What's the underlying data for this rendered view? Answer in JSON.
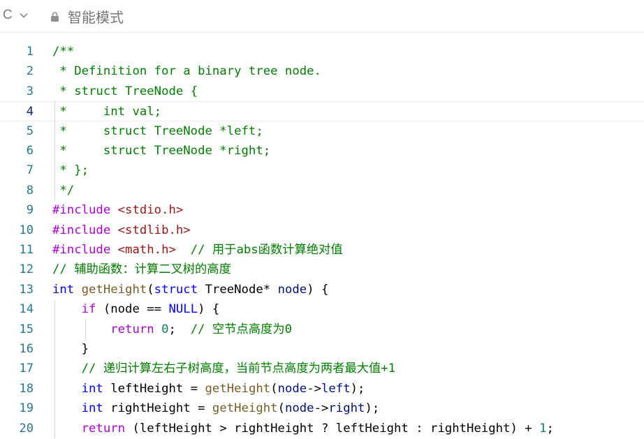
{
  "toolbar": {
    "language": "C",
    "language_dropdown_icon": "chevron-down-icon",
    "mode_icon": "lock-icon",
    "mode_label": "智能模式"
  },
  "editor": {
    "current_line": 4,
    "colors": {
      "line_number": "#237893",
      "comment": "#008000",
      "keyword": "#0000ff",
      "control": "#af00db",
      "string": "#a31515",
      "function": "#795e26",
      "type": "#267f99",
      "variable": "#001080",
      "number": "#098658"
    },
    "lines": [
      {
        "n": "1",
        "tokens": [
          {
            "c": "comment",
            "t": "/**"
          }
        ]
      },
      {
        "n": "2",
        "tokens": [
          {
            "c": "comment",
            "t": " * Definition for a binary tree node."
          }
        ]
      },
      {
        "n": "3",
        "tokens": [
          {
            "c": "comment",
            "t": " * struct TreeNode {"
          }
        ]
      },
      {
        "n": "4",
        "tokens": [
          {
            "c": "comment",
            "t": " *     int val;"
          }
        ]
      },
      {
        "n": "5",
        "tokens": [
          {
            "c": "comment",
            "t": " *     struct TreeNode *left;"
          }
        ]
      },
      {
        "n": "6",
        "tokens": [
          {
            "c": "comment",
            "t": " *     struct TreeNode *right;"
          }
        ]
      },
      {
        "n": "7",
        "tokens": [
          {
            "c": "comment",
            "t": " * };"
          }
        ]
      },
      {
        "n": "8",
        "tokens": [
          {
            "c": "comment",
            "t": " */"
          }
        ]
      },
      {
        "n": "9",
        "tokens": [
          {
            "c": "ctrl",
            "t": "#include"
          },
          {
            "c": "plain",
            "t": " "
          },
          {
            "c": "str",
            "t": "<stdio.h>"
          }
        ]
      },
      {
        "n": "10",
        "tokens": [
          {
            "c": "ctrl",
            "t": "#include"
          },
          {
            "c": "plain",
            "t": " "
          },
          {
            "c": "str",
            "t": "<stdlib.h>"
          }
        ]
      },
      {
        "n": "11",
        "tokens": [
          {
            "c": "ctrl",
            "t": "#include"
          },
          {
            "c": "plain",
            "t": " "
          },
          {
            "c": "str",
            "t": "<math.h>"
          },
          {
            "c": "plain",
            "t": "  "
          },
          {
            "c": "comment",
            "t": "// 用于abs函数计算绝对值"
          }
        ]
      },
      {
        "n": "12",
        "tokens": [
          {
            "c": "comment",
            "t": "// 辅助函数：计算二叉树的高度"
          }
        ]
      },
      {
        "n": "13",
        "tokens": [
          {
            "c": "kw",
            "t": "int"
          },
          {
            "c": "plain",
            "t": " "
          },
          {
            "c": "fn",
            "t": "getHeight"
          },
          {
            "c": "plain",
            "t": "("
          },
          {
            "c": "kw",
            "t": "struct"
          },
          {
            "c": "plain",
            "t": " TreeNode* "
          },
          {
            "c": "var",
            "t": "node"
          },
          {
            "c": "plain",
            "t": ") {"
          }
        ]
      },
      {
        "n": "14",
        "tokens": [
          {
            "c": "plain",
            "t": "    "
          },
          {
            "c": "ctrl",
            "t": "if"
          },
          {
            "c": "plain",
            "t": " (node == "
          },
          {
            "c": "const",
            "t": "NULL"
          },
          {
            "c": "plain",
            "t": ") {"
          }
        ]
      },
      {
        "n": "15",
        "tokens": [
          {
            "c": "plain",
            "t": "        "
          },
          {
            "c": "ctrl",
            "t": "return"
          },
          {
            "c": "plain",
            "t": " "
          },
          {
            "c": "num",
            "t": "0"
          },
          {
            "c": "plain",
            "t": ";  "
          },
          {
            "c": "comment",
            "t": "// 空节点高度为0"
          }
        ]
      },
      {
        "n": "16",
        "tokens": [
          {
            "c": "plain",
            "t": "    }"
          }
        ]
      },
      {
        "n": "17",
        "tokens": [
          {
            "c": "plain",
            "t": "    "
          },
          {
            "c": "comment",
            "t": "// 递归计算左右子树高度，当前节点高度为两者最大值+1"
          }
        ]
      },
      {
        "n": "18",
        "tokens": [
          {
            "c": "plain",
            "t": "    "
          },
          {
            "c": "kw",
            "t": "int"
          },
          {
            "c": "plain",
            "t": " leftHeight = "
          },
          {
            "c": "fn",
            "t": "getHeight"
          },
          {
            "c": "plain",
            "t": "("
          },
          {
            "c": "var",
            "t": "node"
          },
          {
            "c": "plain",
            "t": "->"
          },
          {
            "c": "var",
            "t": "left"
          },
          {
            "c": "plain",
            "t": ");"
          }
        ]
      },
      {
        "n": "19",
        "tokens": [
          {
            "c": "plain",
            "t": "    "
          },
          {
            "c": "kw",
            "t": "int"
          },
          {
            "c": "plain",
            "t": " rightHeight = "
          },
          {
            "c": "fn",
            "t": "getHeight"
          },
          {
            "c": "plain",
            "t": "("
          },
          {
            "c": "var",
            "t": "node"
          },
          {
            "c": "plain",
            "t": "->"
          },
          {
            "c": "var",
            "t": "right"
          },
          {
            "c": "plain",
            "t": ");"
          }
        ]
      },
      {
        "n": "20",
        "tokens": [
          {
            "c": "plain",
            "t": "    "
          },
          {
            "c": "ctrl",
            "t": "return"
          },
          {
            "c": "plain",
            "t": " (leftHeight > rightHeight ? leftHeight : rightHeight) + "
          },
          {
            "c": "num",
            "t": "1"
          },
          {
            "c": "plain",
            "t": ";"
          }
        ]
      }
    ]
  }
}
